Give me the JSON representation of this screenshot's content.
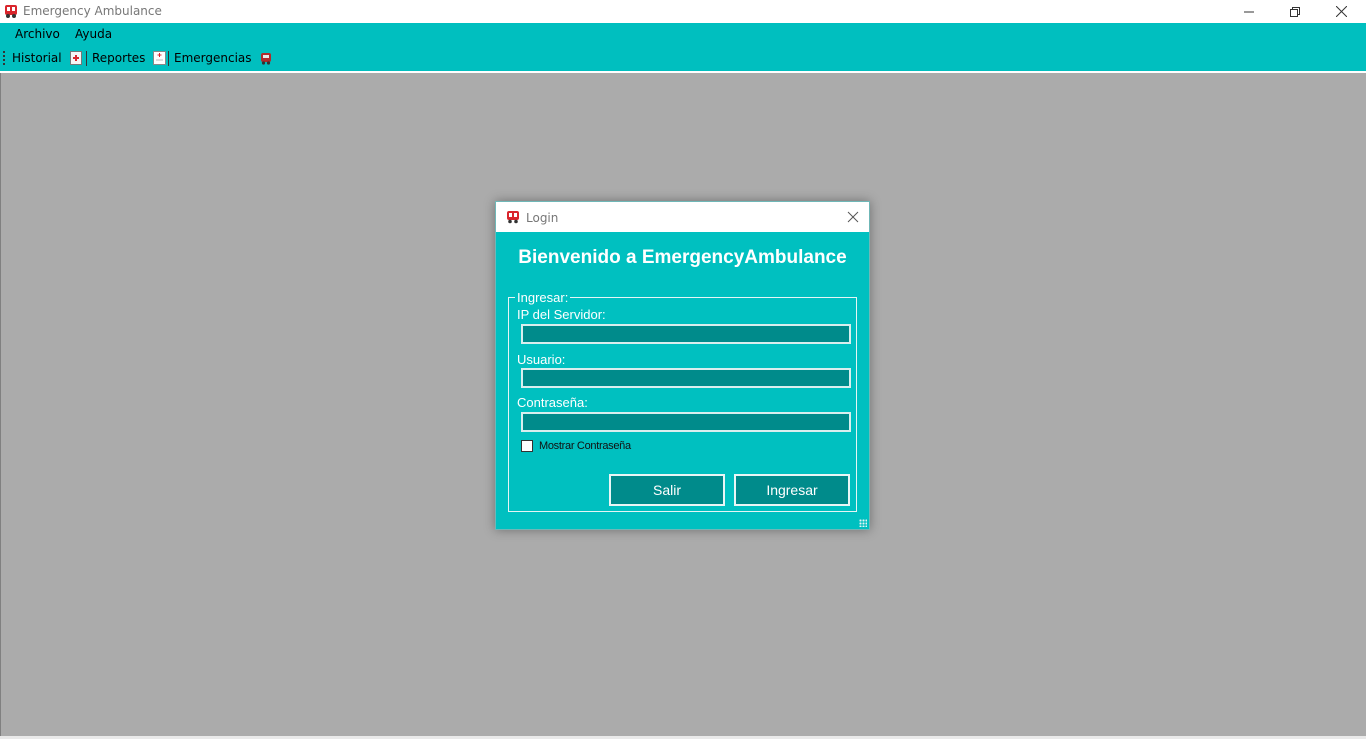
{
  "window": {
    "title": "Emergency Ambulance",
    "icon": "ambulance-icon",
    "controls": [
      "minimize-icon",
      "restore-icon",
      "close-icon"
    ]
  },
  "menubar": {
    "items": [
      {
        "label": "Archivo"
      },
      {
        "label": "Ayuda"
      }
    ]
  },
  "toolbar": {
    "items": [
      {
        "label": "Historial",
        "icon": "medical-folder-icon"
      },
      {
        "label": "Reportes",
        "icon": "report-document-icon"
      },
      {
        "label": "Emergencias",
        "icon": "ambulance-icon"
      }
    ]
  },
  "login": {
    "title": "Login",
    "icon": "ambulance-icon",
    "welcome": "Bienvenido a EmergencyAmbulance",
    "group_label": "Ingresar:",
    "server_ip_label": "IP del Servidor:",
    "server_ip_value": "",
    "user_label": "Usuario:",
    "user_value": "",
    "password_label": "Contraseña:",
    "password_value": "",
    "show_password_label": "Mostrar Contraseña",
    "show_password_checked": false,
    "exit_button": "Salir",
    "login_button": "Ingresar"
  },
  "colors": {
    "accent": "#00bfbf",
    "field_bg": "#008b8b",
    "workspace": "#ababab",
    "icon_red": "#d9252c"
  }
}
